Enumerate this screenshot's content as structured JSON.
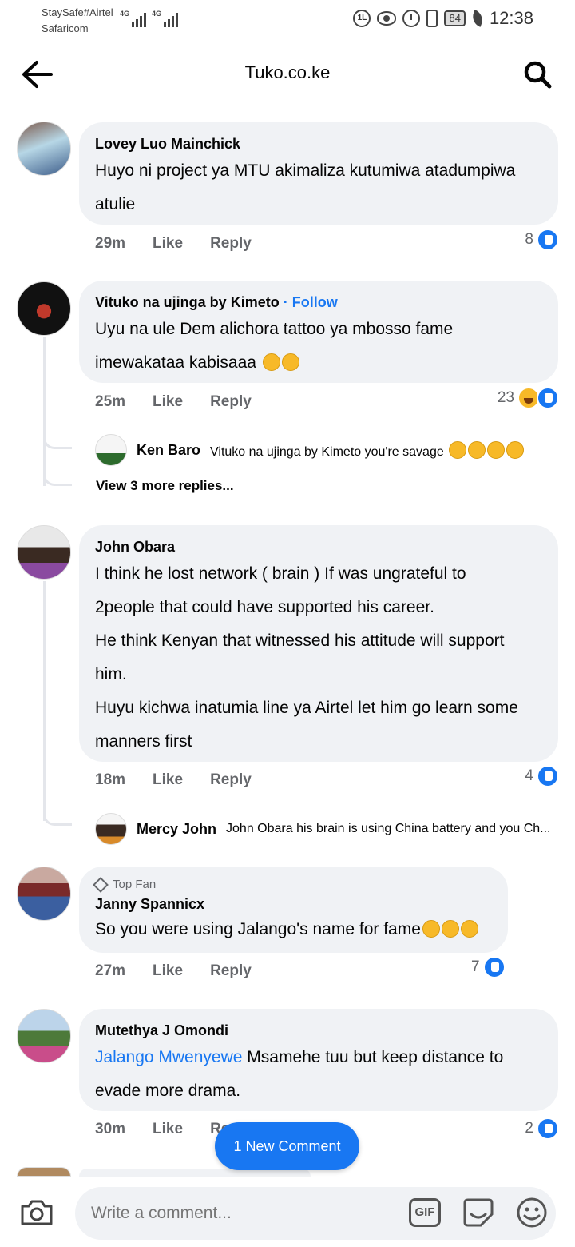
{
  "status_bar": {
    "carrier_line1": "StaySafe#Airtel",
    "carrier_line2": "Safaricom",
    "net1": "4G",
    "net2": "4G",
    "battery": "84",
    "time": "12:38"
  },
  "app_bar": {
    "title": "Tuko.co.ke",
    "back_icon": "back-arrow-icon",
    "search_icon": "search-icon"
  },
  "comments": [
    {
      "author": "Lovey Luo Mainchick",
      "lines": [
        "Huyo ni project ya MTU akimaliza kutumiwa atadumpiwa",
        "atulie"
      ],
      "time": "29m",
      "like": "Like",
      "reply": "Reply",
      "reaction_count": "8"
    },
    {
      "author": "Vituko na ujinga by Kimeto",
      "follow": "· Follow",
      "lines": [
        "Uyu na ule Dem alichora tattoo ya mbosso fame",
        "imewakataa kabisaaa"
      ],
      "time": "25m",
      "like": "Like",
      "reply": "Reply",
      "reaction_count": "23",
      "reply_preview": {
        "author": "Ken Baro",
        "text": "Vituko na ujinga by Kimeto you're savage"
      },
      "view_more": "View 3 more replies..."
    },
    {
      "author": "John Obara",
      "lines": [
        "I think he lost network ( brain ) If was ungrateful to",
        "2people that could have  supported  his career.",
        "He think Kenyan that witnessed his attitude will support",
        "him.",
        "Huyu kichwa inatumia line ya Airtel let him go learn some",
        "manners first"
      ],
      "time": "18m",
      "like": "Like",
      "reply": "Reply",
      "reaction_count": "4",
      "reply_preview": {
        "author": "Mercy John",
        "text": "John Obara his brain is using China battery and you Ch..."
      }
    },
    {
      "badge": "Top Fan",
      "author": "Janny Spannicx",
      "lines": [
        "So you were using Jalango's name for fame"
      ],
      "time": "27m",
      "like": "Like",
      "reply": "Reply",
      "reaction_count": "7"
    },
    {
      "author": "Mutethya J Omondi",
      "mention": "Jalango Mwenyewe",
      "lines": [
        " Msamehe tuu but keep distance to",
        "evade more drama."
      ],
      "time": "30m",
      "like": "Like",
      "reply": "Re",
      "reaction_count": "2"
    }
  ],
  "new_comment_pill": "1 New Comment",
  "composer": {
    "placeholder": "Write a comment...",
    "gif_label": "GIF"
  },
  "colors": {
    "accent": "#1877f2",
    "bubble": "#f0f2f5",
    "muted_text": "#65676b"
  }
}
